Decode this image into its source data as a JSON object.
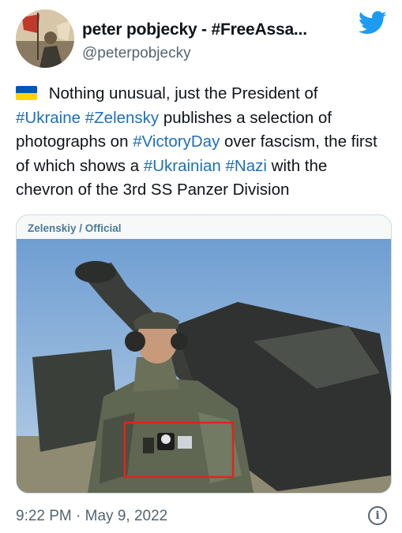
{
  "user": {
    "display_name": "peter pobjecky - #FreeAssa...",
    "handle": "@peterpobjecky"
  },
  "tweet": {
    "flag_colors": [
      "#0057b7",
      "#ffd700"
    ],
    "text_parts": [
      {
        "text": " Nothing unusual, just the President of ",
        "hashtag": false
      },
      {
        "text": "#Ukraine",
        "hashtag": true
      },
      {
        "text": " ",
        "hashtag": false
      },
      {
        "text": "#Zelensky",
        "hashtag": true
      },
      {
        "text": " publishes a selection of photographs on ",
        "hashtag": false
      },
      {
        "text": "#VictoryDay",
        "hashtag": true
      },
      {
        "text": " over fascism, the first of which shows a ",
        "hashtag": false
      },
      {
        "text": "#Ukrainian",
        "hashtag": true
      },
      {
        "text": " ",
        "hashtag": false
      },
      {
        "text": "#Nazi",
        "hashtag": true
      },
      {
        "text": " with the chevron of the 3rd SS Panzer Division",
        "hashtag": false
      }
    ],
    "media_label": "Zelenskiy / Official",
    "timestamp": "9:22 PM · May 9, 2022"
  },
  "icons": {
    "brand": "twitter-bird-icon",
    "info": "info-icon",
    "info_glyph": "i"
  },
  "colors": {
    "hashtag": "#1d6fb8",
    "brand_blue": "#1d9bf0",
    "highlight_box": "#e0241c"
  }
}
